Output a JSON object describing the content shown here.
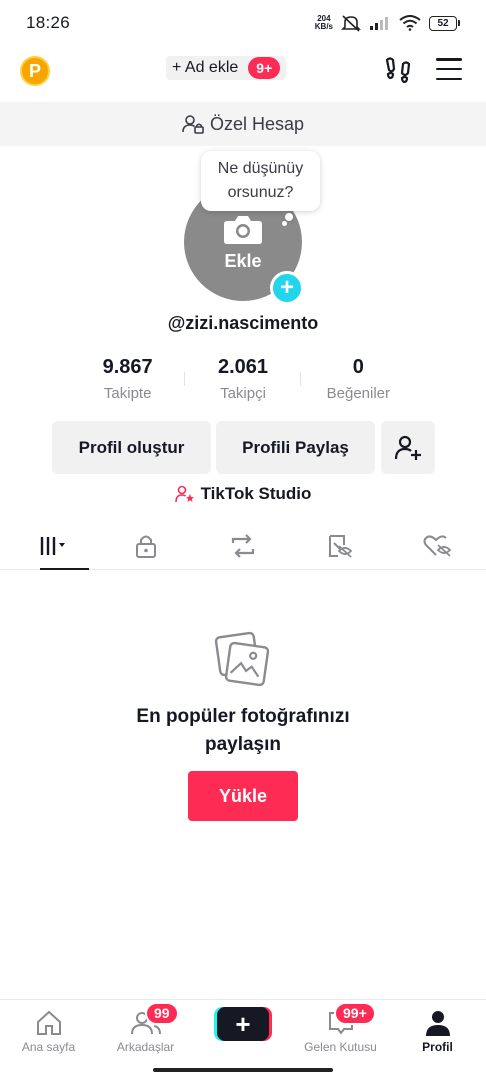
{
  "status_bar": {
    "time": "18:26",
    "net_speed_value": "204",
    "net_speed_unit": "KB/s",
    "battery": "52"
  },
  "header": {
    "coin_letter": "P",
    "add_account_label": "+ Ad ekle",
    "add_account_badge": "9+"
  },
  "private_banner": {
    "label": "Özel Hesap"
  },
  "avatar": {
    "bubble_line1": "Ne düşünüy",
    "bubble_line2": "orsunuz?",
    "add_label": "Ekle",
    "plus": "+"
  },
  "profile": {
    "username": "@zizi.nascimento"
  },
  "stats": [
    {
      "value": "9.867",
      "label": "Takipte"
    },
    {
      "value": "2.061",
      "label": "Takipçi"
    },
    {
      "value": "0",
      "label": "Beğeniler"
    }
  ],
  "actions": {
    "create_profile": "Profil oluştur",
    "share_profile": "Profili Paylaş",
    "add_friend_icon": "add-user-icon"
  },
  "studio": {
    "label": "TikTok Studio"
  },
  "tabs": [
    {
      "icon": "grid-icon",
      "active": true
    },
    {
      "icon": "lock-icon",
      "active": false
    },
    {
      "icon": "repost-icon",
      "active": false
    },
    {
      "icon": "tagged-icon",
      "active": false
    },
    {
      "icon": "liked-icon",
      "active": false
    }
  ],
  "empty_state": {
    "icon": "photos-icon",
    "title_line1": "En popüler fotoğrafınızı",
    "title_line2": "paylaşın",
    "upload_label": "Yükle"
  },
  "bottom_nav": {
    "home": "Ana sayfa",
    "friends": "Arkadaşlar",
    "friends_badge": "99",
    "create": "+",
    "inbox": "Gelen Kutusu",
    "inbox_badge": "99+",
    "profile": "Profil"
  },
  "colors": {
    "accent": "#fe2c55",
    "cyan": "#20d5ec",
    "text": "#161823",
    "muted": "#8a8b91"
  }
}
